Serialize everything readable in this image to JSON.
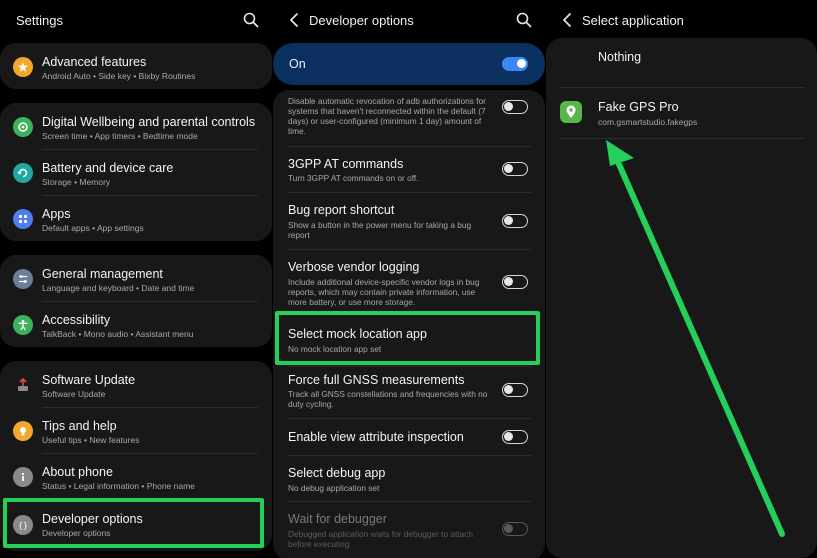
{
  "settings": {
    "title": "Settings",
    "items": [
      {
        "title": "Advanced features",
        "subtitle": "Android Auto  •  Side key  •  Bixby Routines",
        "icon": "star-plus-icon",
        "color": "#f3a72c"
      },
      {
        "title": "Digital Wellbeing and parental controls",
        "subtitle": "Screen time  •  App timers  •  Bedtime mode",
        "icon": "wellbeing-icon",
        "color": "#3bb35a"
      },
      {
        "title": "Battery and device care",
        "subtitle": "Storage  •  Memory",
        "icon": "device-care-icon",
        "color": "#1fa9a1"
      },
      {
        "title": "Apps",
        "subtitle": "Default apps  •  App settings",
        "icon": "apps-icon",
        "color": "#4d7ff0"
      },
      {
        "title": "General management",
        "subtitle": "Language and keyboard  •  Date and time",
        "icon": "sliders-icon",
        "color": "#6b7f99"
      },
      {
        "title": "Accessibility",
        "subtitle": "TalkBack  •  Mono audio  •  Assistant menu",
        "icon": "accessibility-icon",
        "color": "#3bb35a"
      },
      {
        "title": "Software Update",
        "subtitle": "Software Update",
        "icon": "software-update-icon",
        "color": "#6b6b6b"
      },
      {
        "title": "Tips and help",
        "subtitle": "Useful tips  •  New features",
        "icon": "bulb-icon",
        "color": "#f3a72c"
      },
      {
        "title": "About phone",
        "subtitle": "Status  •  Legal information  •  Phone name",
        "icon": "info-icon",
        "color": "#8a8a8a"
      },
      {
        "title": "Developer options",
        "subtitle": "Developer options",
        "icon": "braces-icon",
        "color": "#8a8a8a"
      }
    ]
  },
  "developer": {
    "title": "Developer options",
    "master_label": "On",
    "items": [
      {
        "title": "",
        "subtitle": "Disable automatic revocation of adb authorizations for systems that haven't reconnected within the default (7 days) or user-configured (minimum 1 day) amount of time.",
        "toggle": "off"
      },
      {
        "title": "3GPP AT commands",
        "subtitle": "Turn 3GPP AT commands on or off.",
        "toggle": "off"
      },
      {
        "title": "Bug report shortcut",
        "subtitle": "Show a button in the power menu for taking a bug report",
        "toggle": "off"
      },
      {
        "title": "Verbose vendor logging",
        "subtitle": "Include additional device-specific vendor logs in bug reports, which may contain private information, use more battery, or use more storage.",
        "toggle": "off"
      },
      {
        "title": "Select mock location app",
        "subtitle": "No mock location app set",
        "toggle": "none"
      },
      {
        "title": "Force full GNSS measurements",
        "subtitle": "Track all GNSS constellations and frequencies with no duty cycling.",
        "toggle": "off"
      },
      {
        "title": "Enable view attribute inspection",
        "subtitle": "",
        "toggle": "off"
      },
      {
        "title": "Select debug app",
        "subtitle": "No debug application set",
        "toggle": "none"
      },
      {
        "title": "Wait for debugger",
        "subtitle": "Debugged application waits for debugger to attach before executing",
        "toggle": "disabled"
      }
    ]
  },
  "select_app": {
    "title": "Select application",
    "items": [
      {
        "title": "Nothing",
        "subtitle": ""
      },
      {
        "title": "Fake GPS Pro",
        "subtitle": "com.gsmartstudio.fakegps",
        "icon": "location-pin-icon",
        "color": "#5ab54b"
      }
    ]
  },
  "colors": {
    "highlight": "#24d05a",
    "accent": "#3d87f5",
    "master_bar": "#0b2f5f"
  }
}
